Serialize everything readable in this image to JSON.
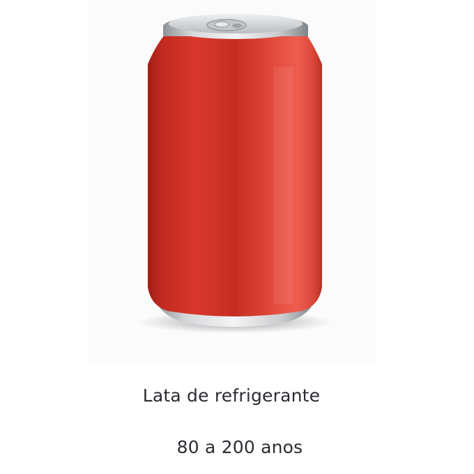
{
  "image": {
    "subject": "red-aluminum-soda-can",
    "colors": {
      "can_red": "#d8372d",
      "can_red_dark": "#a82018",
      "can_red_light": "#ee5a4c",
      "metal": "#c9ccd0",
      "background": "#ffffff"
    }
  },
  "caption": {
    "title": "Lata de refrigerante",
    "decomposition_time": "80 a 200 anos"
  }
}
